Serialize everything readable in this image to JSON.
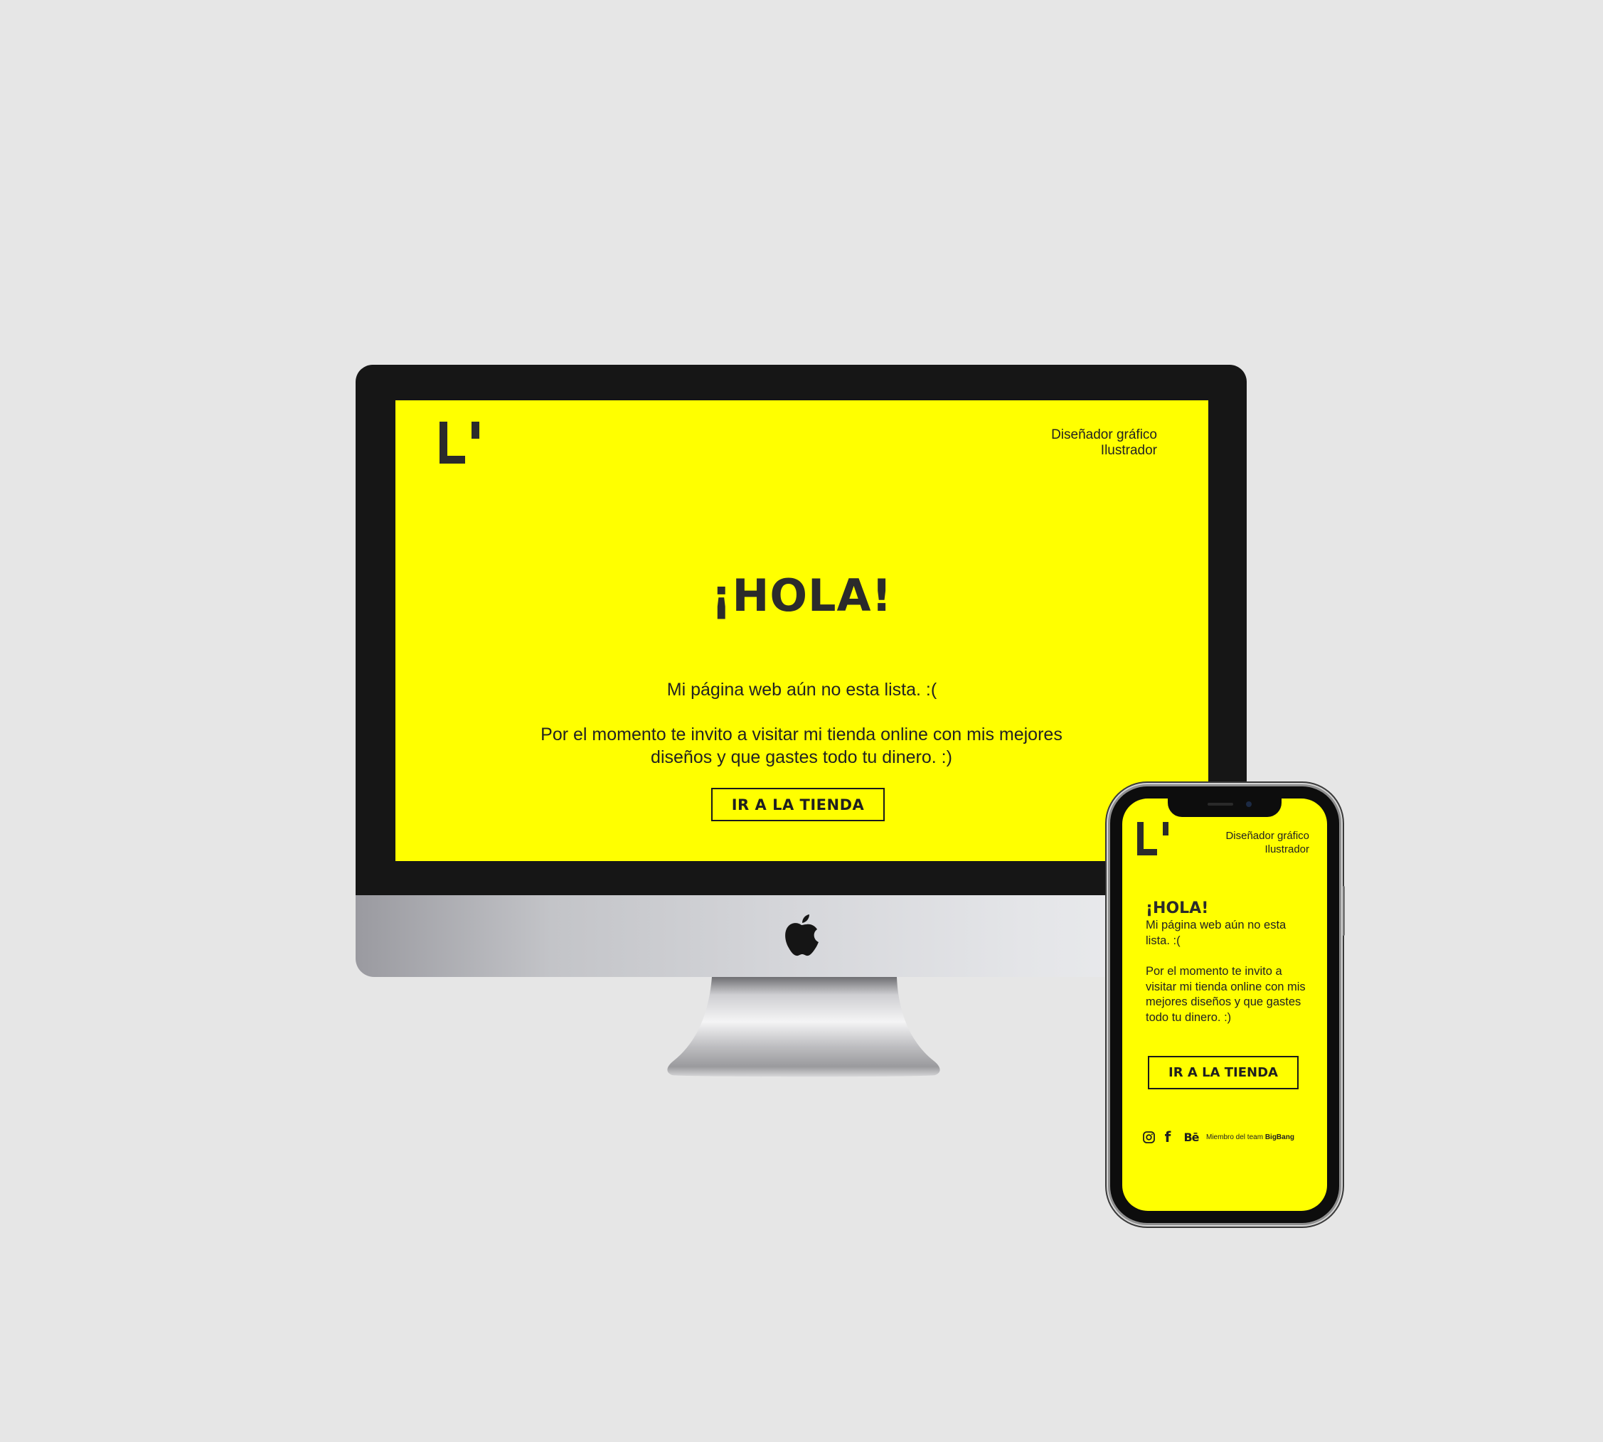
{
  "brand": {
    "logo_letter": "L'",
    "accent_color": "#ffff00",
    "text_color": "#222222",
    "bezel_color": "#161616",
    "background_color": "#e6e6e6"
  },
  "desktop": {
    "tagline_line1": "Diseñador gráfico",
    "tagline_line2": "Ilustrador",
    "title": "¡HOLA!",
    "message1": "Mi página web aún no esta lista. :(",
    "message2": "Por el momento te invito a visitar mi tienda online con mis mejores diseños y que gastes todo tu dinero. :)",
    "cta_label": "IR A LA TIENDA"
  },
  "mobile": {
    "tagline_line1": "Diseñador gráfico",
    "tagline_line2": "Ilustrador",
    "title": "¡HOLA!",
    "message1": "Mi página web aún no esta lista. :(",
    "message2": "Por el momento te invito a visitar mi tienda online con mis mejores diseños y que gastes todo tu dinero. :)",
    "cta_label": "IR A LA TIENDA",
    "footer": {
      "instagram_icon": "instagram-icon",
      "facebook_icon": "facebook-icon",
      "facebook_glyph": "f",
      "behance_icon": "behance-icon",
      "behance_glyph": "Bē",
      "credit_prefix": "Miembro del team",
      "credit_team": "BigBang"
    }
  },
  "device_icons": {
    "apple_logo": "apple-logo-icon"
  }
}
